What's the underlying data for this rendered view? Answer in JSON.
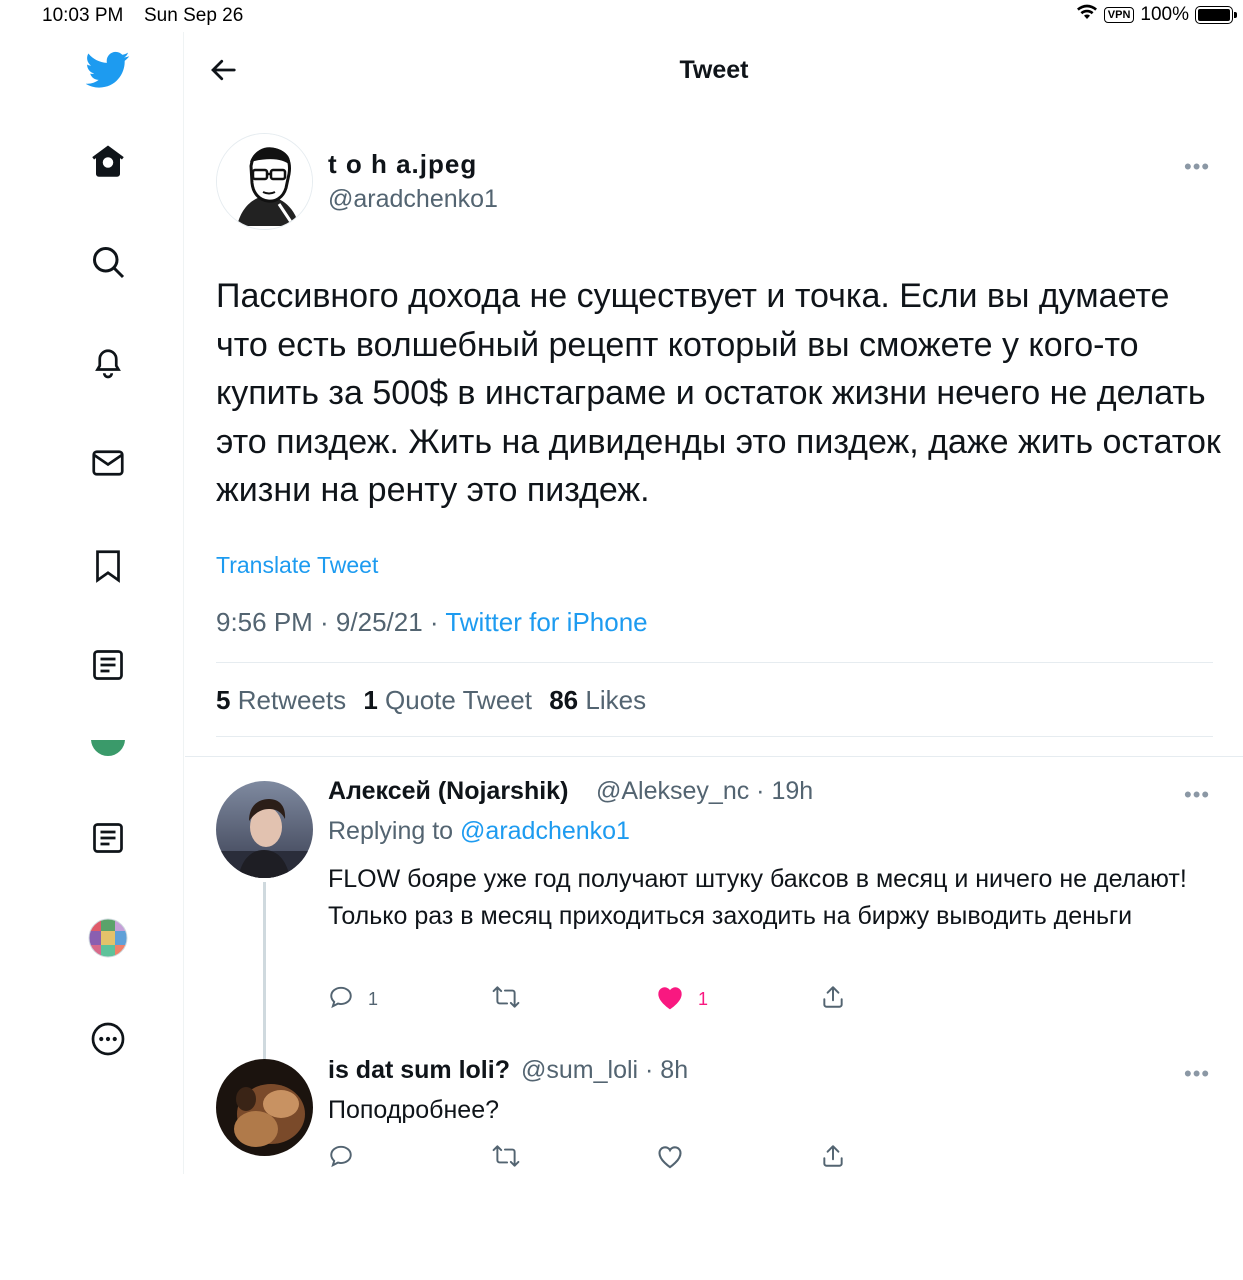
{
  "status_bar": {
    "time": "10:03 PM",
    "date": "Sun Sep 26",
    "vpn": "VPN",
    "battery": "100%"
  },
  "header": {
    "title": "Tweet"
  },
  "sidebar": {
    "items": [
      {
        "icon": "twitter-logo-icon"
      },
      {
        "icon": "home-icon"
      },
      {
        "icon": "search-icon"
      },
      {
        "icon": "bell-icon"
      },
      {
        "icon": "mail-icon"
      },
      {
        "icon": "bookmark-icon"
      },
      {
        "icon": "list-icon"
      },
      {
        "icon": "list-icon"
      },
      {
        "icon": "profile-avatar"
      },
      {
        "icon": "more-icon"
      }
    ]
  },
  "tweet": {
    "author_name": "t o h a.jpeg",
    "author_handle": "@aradchenko1",
    "text": "Пассивного дохода не существует и точка. Если вы думаете что есть волшебный рецепт который вы сможете у кого-то купить за 500$ в инстаграме и остаток жизни нечего не делать это пиздеж. Жить на дивиденды это пиздеж, даже жить остаток жизни на ренту это пиздеж.",
    "translate": "Translate Tweet",
    "timestamp": "9:56 PM · 9/25/21 · ",
    "source": "Twitter for iPhone",
    "retweets_count": "5",
    "retweets_label": "Retweets",
    "quotes_count": "1",
    "quotes_label": "Quote Tweet",
    "likes_count": "86",
    "likes_label": "Likes"
  },
  "replies": [
    {
      "name": "Алексей (Nojarshik)",
      "handle": "@Aleksey_nc · 19h",
      "replying_prefix": "Replying to ",
      "replying_to": "@aradchenko1",
      "text": "FLOW бояре уже год получают штуку баксов в месяц и ничего не делают! Только раз в месяц приходиться заходить на биржу выводить деньги",
      "reply_count": "1",
      "retweet_count": "",
      "like_count": "1",
      "liked": true
    },
    {
      "name": "is dat sum loli?",
      "handle": "@sum_loli · 8h",
      "text": "Поподробнее?",
      "reply_count": "",
      "retweet_count": "",
      "like_count": "",
      "liked": false
    }
  ],
  "colors": {
    "accent": "#1d9bf0",
    "like": "#f91880",
    "muted": "#536471"
  }
}
